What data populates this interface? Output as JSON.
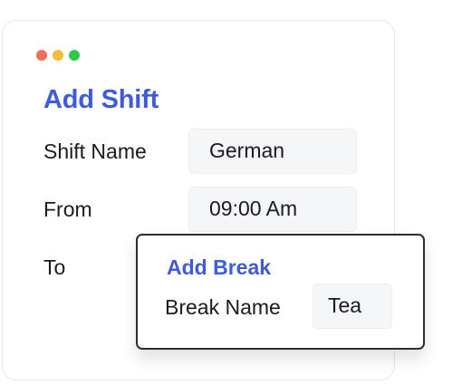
{
  "window": {
    "controls": [
      {
        "name": "close",
        "color": "#f26b5b"
      },
      {
        "name": "minimize",
        "color": "#f5bd3a"
      },
      {
        "name": "maximize",
        "color": "#2fc84c"
      }
    ]
  },
  "form": {
    "title": "Add Shift",
    "accent_color": "#3d5bdb",
    "shift_name": {
      "label": "Shift Name",
      "value": "German"
    },
    "from": {
      "label": "From",
      "value": "09:00 Am"
    },
    "to": {
      "label": "To"
    }
  },
  "break_popup": {
    "title": "Add Break",
    "break_name": {
      "label": "Break Name",
      "value": "Tea"
    }
  }
}
